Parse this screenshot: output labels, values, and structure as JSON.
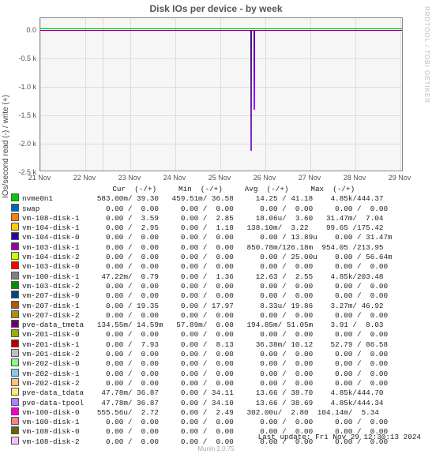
{
  "title": "Disk IOs per device - by week",
  "ylabel": "IOs/second read (-) / write (+)",
  "watermark": "RRDTOOL / TOBI OETIKER",
  "footer": "Munin 2.0.75",
  "last_update": "Last update: Fri Nov 29 12:30:13 2024",
  "yticks": [
    "0.0",
    "-0.5 k",
    "-1.0 k",
    "-1.5 k",
    "-2.0 k",
    "-2.5 k"
  ],
  "xticks": [
    "21 Nov",
    "22 Nov",
    "23 Nov",
    "24 Nov",
    "25 Nov",
    "26 Nov",
    "27 Nov",
    "28 Nov",
    "29 Nov"
  ],
  "header_row": "                    Cur  (-/+)     Min  (-/+)     Avg  (-/+)     Max  (-/+)",
  "rows": [
    {
      "c": "#00cc00",
      "n": "nvme0n1        ",
      "v": "583.00m/ 39.30   459.51m/ 36.58     14.25 / 41.18    4.85k/444.37"
    },
    {
      "c": "#0066b3",
      "n": "swap           ",
      "v": "  0.00 /  0.00     0.00 /  0.00      0.00 /  0.00     0.00 /  0.00"
    },
    {
      "c": "#ff8000",
      "n": "vm-108-disk-1  ",
      "v": "  0.00 /  3.59     0.00 /  2.85     18.06u/  3.60   31.47m/  7.04"
    },
    {
      "c": "#ffcc00",
      "n": "vm-104-disk-1  ",
      "v": "  0.00 /  2.95     0.00 /  1.18   138.10m/  3.22    99.65 /175.42"
    },
    {
      "c": "#330099",
      "n": "vm-104-disk-0  ",
      "v": "  0.00 /  0.00     0.00 /  0.00      0.00 / 13.89u    0.00 / 31.47m"
    },
    {
      "c": "#990099",
      "n": "vm-103-disk-1  ",
      "v": "  0.00 /  0.00     0.00 /  0.00   850.78m/126.18m  954.05 /213.95"
    },
    {
      "c": "#ccff00",
      "n": "vm-104-disk-2  ",
      "v": "  0.00 /  0.00     0.00 /  0.00      0.00 / 25.00u    0.00 / 56.64m"
    },
    {
      "c": "#ff0000",
      "n": "vm-103-disk-0  ",
      "v": "  0.00 /  0.00     0.00 /  0.00      0.00 /  0.00     0.00 /  0.00"
    },
    {
      "c": "#808080",
      "n": "vm-100-disk-1  ",
      "v": " 47.22m/  0.79     0.00 /  1.36     12.63 /  2.55    4.85k/203.48"
    },
    {
      "c": "#008f00",
      "n": "vm-103-disk-2  ",
      "v": "  0.00 /  0.00     0.00 /  0.00      0.00 /  0.00     0.00 /  0.00"
    },
    {
      "c": "#00487d",
      "n": "vm-207-disk-0  ",
      "v": "  0.00 /  0.00     0.00 /  0.00      0.00 /  0.00     0.00 /  0.00"
    },
    {
      "c": "#b35a00",
      "n": "vm-207-disk-1  ",
      "v": "  0.00 / 19.35     0.00 / 17.97      8.33u/ 19.86    3.27m/ 46.92"
    },
    {
      "c": "#b38f00",
      "n": "vm-207-disk-2  ",
      "v": "  0.00 /  0.00     0.00 /  0.00      0.00 /  0.00     0.00 /  0.00"
    },
    {
      "c": "#6b006b",
      "n": "pve-data_tmeta ",
      "v": "134.55m/ 14.59m   57.89m/  0.00   194.85m/ 51.05m    3.91 /  8.03"
    },
    {
      "c": "#8fb300",
      "n": "vm-201-disk-0  ",
      "v": "  0.00 /  0.00     0.00 /  0.00      0.00 /  0.00     0.00 /  0.00"
    },
    {
      "c": "#b30000",
      "n": "vm-201-disk-1  ",
      "v": "  0.00 /  7.93     0.00 /  8.13     36.38m/ 10.12    52.79 / 86.58"
    },
    {
      "c": "#bebebe",
      "n": "vm-201-disk-2  ",
      "v": "  0.00 /  0.00     0.00 /  0.00      0.00 /  0.00     0.00 /  0.00"
    },
    {
      "c": "#80ff80",
      "n": "vm-202-disk-0  ",
      "v": "  0.00 /  0.00     0.00 /  0.00      0.00 /  0.00     0.00 /  0.00"
    },
    {
      "c": "#80c9ff",
      "n": "vm-202-disk-1  ",
      "v": "  0.00 /  0.00     0.00 /  0.00      0.00 /  0.00     0.00 /  0.00"
    },
    {
      "c": "#ffc080",
      "n": "vm-202-disk-2  ",
      "v": "  0.00 /  0.00     0.00 /  0.00      0.00 /  0.00     0.00 /  0.00"
    },
    {
      "c": "#ffe680",
      "n": "pve-data_tdata ",
      "v": " 47.78m/ 36.87     0.00 / 34.11     13.66 / 38.70    4.85k/444.70"
    },
    {
      "c": "#aa80ff",
      "n": "pve-data-tpool ",
      "v": " 47.78m/ 36.87     0.00 / 34.10     13.66 / 38.69    4.85k/444.34"
    },
    {
      "c": "#ee00cc",
      "n": "vm-100-disk-0  ",
      "v": "555.56u/  2.72     0.00 /  2.49   302.00u/  2.80  104.14m/  5.34"
    },
    {
      "c": "#ff8080",
      "n": "vm-100-disk-1  ",
      "v": "  0.00 /  0.00     0.00 /  0.00      0.00 /  0.00     0.00 /  0.00"
    },
    {
      "c": "#666600",
      "n": "vm-108-disk-0  ",
      "v": "  0.00 /  0.00     0.00 /  0.00      0.00 /  0.00     0.00 /  0.00"
    },
    {
      "c": "#ffbfff",
      "n": "vm-108-disk-2  ",
      "v": "  0.00 /  0.00     0.00 /  0.00      0.00 /  0.00     0.00 /  0.00"
    }
  ],
  "chart_data": {
    "type": "line",
    "title": "Disk IOs per device - by week",
    "xlabel": "",
    "ylabel": "IOs/second read (-) / write (+)",
    "ylim": [
      -2700,
      100
    ],
    "x_range": [
      "2024-11-21",
      "2024-11-29"
    ],
    "note": "All series hover near 0 for the full week. Two short downward read spikes occur between 25 Nov and 26 Nov reaching roughly -2100 and -1400 IOs/s (read).",
    "series_summary": "26 devices tracked; nvme0n1, vm-100-disk-1, pve-data_tdata, pve-data-tpool show max ~4.85k; others near zero."
  }
}
